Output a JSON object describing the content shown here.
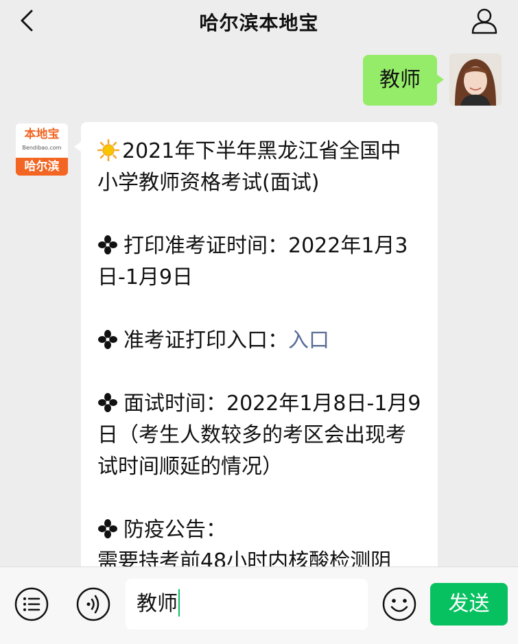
{
  "header": {
    "title": "哈尔滨本地宝",
    "back_icon": "chevron-left-icon",
    "profile_icon": "user-icon"
  },
  "messages": {
    "outgoing": {
      "text": "教师",
      "bubble_color": "#95ec69"
    },
    "incoming": {
      "sender_logo": {
        "top_text": "本地宝",
        "site_text": "Bendibao.com",
        "city_text": "哈尔滨",
        "accent_color": "#f26522"
      },
      "exam_title": "2021年下半年黑龙江省全国中小学教师资格考试(面试)",
      "print_time_label": "打印准考证时间：",
      "print_time_value": "2022年1月3日-1月9日",
      "entry_label": "准考证打印入口：",
      "entry_link": "入口",
      "interview_label": "面试时间：",
      "interview_value": "2022年1月8日-1月9日（考生人数较多的考区会出现考试时间顺延的情况）",
      "notice_label": "防疫公告：",
      "notice_text": "需要持考前48小时内核酸检测阴"
    }
  },
  "input_bar": {
    "value": "教师",
    "send_label": "发送",
    "send_color": "#07c160",
    "menu_icon": "list-icon",
    "voice_icon": "voice-icon",
    "emoji_icon": "emoji-icon"
  },
  "colors": {
    "link": "#576b95",
    "background": "#ededed"
  }
}
